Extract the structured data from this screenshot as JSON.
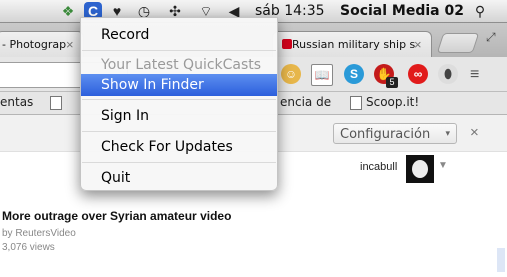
{
  "menubar": {
    "clock": "sáb 14:35",
    "user": "Social Media 02",
    "quickcast_glyph": "C"
  },
  "browser": {
    "tabs": [
      {
        "label": "- Photograp"
      },
      {
        "label": "Russian military ship s"
      }
    ],
    "bookmarks": [
      {
        "label": "entas"
      },
      {
        "label": "encia de"
      },
      {
        "label": "Scoop.it!"
      }
    ],
    "extension_badge": "5"
  },
  "menu": {
    "items": [
      {
        "label": "Record"
      },
      {
        "label": "Your Latest QuickCasts"
      },
      {
        "label": "Show In Finder"
      },
      {
        "label": "Sign In"
      },
      {
        "label": "Check For Updates"
      },
      {
        "label": "Quit"
      }
    ]
  },
  "page": {
    "config_button": "Configuración",
    "username": "incabull",
    "video": {
      "title": "More outrage over Syrian amateur video",
      "channel": "by ReutersVideo",
      "views": "3,076 views"
    }
  },
  "colors": {
    "highlight": "#2c5fdc",
    "quickcast_icon": "#2c63ce"
  }
}
